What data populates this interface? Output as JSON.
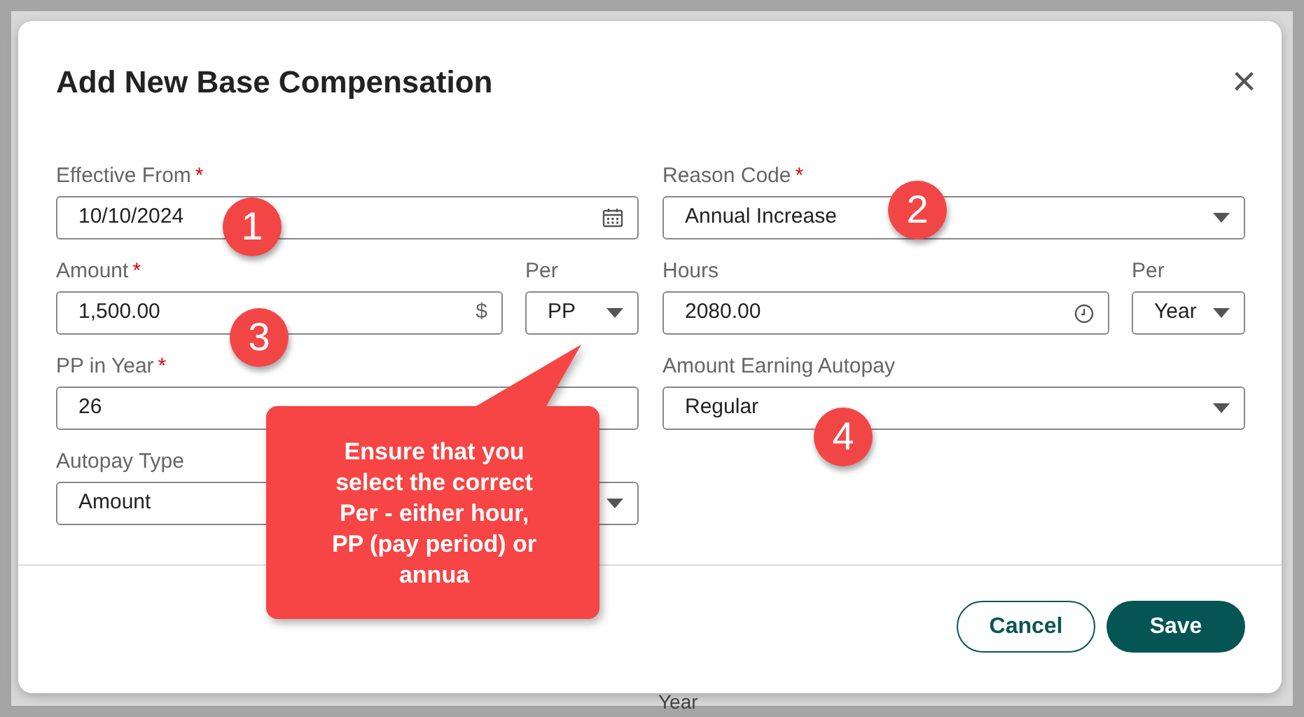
{
  "background": {
    "peek_text": "Year"
  },
  "dialog": {
    "title": "Add New Base Compensation",
    "close": "×",
    "left_column": [
      {
        "kind": "date",
        "label": "Effective From",
        "required_mark": "*",
        "value": "10/10/2024"
      },
      {
        "kind": "amount",
        "label": "Amount",
        "required_mark": "*",
        "value": "1,500.00",
        "suffix": "$",
        "per": {
          "label": "Per",
          "value": "PP"
        }
      },
      {
        "kind": "text",
        "label": "PP in Year",
        "required_mark": "*",
        "value": "26"
      },
      {
        "kind": "select",
        "label": "Autopay Type",
        "value": "Amount"
      }
    ],
    "right_column": [
      {
        "kind": "select",
        "label": "Reason Code",
        "required_mark": "*",
        "value": "Annual Increase"
      },
      {
        "kind": "time",
        "label": "Hours",
        "value": "2080.00",
        "per": {
          "label": "Per",
          "value": "Year"
        }
      },
      {
        "kind": "select",
        "label": "Amount Earning Autopay",
        "value": "Regular"
      }
    ],
    "buttons": [
      {
        "label": "Cancel",
        "kind": "secondary"
      },
      {
        "label": "Save",
        "kind": "primary"
      }
    ]
  },
  "annotations": {
    "markers": [
      "1",
      "2",
      "3",
      "4"
    ],
    "callout": "Ensure that you\nselect the correct\nPer - either hour,\nPP (pay period) or\nannua"
  }
}
